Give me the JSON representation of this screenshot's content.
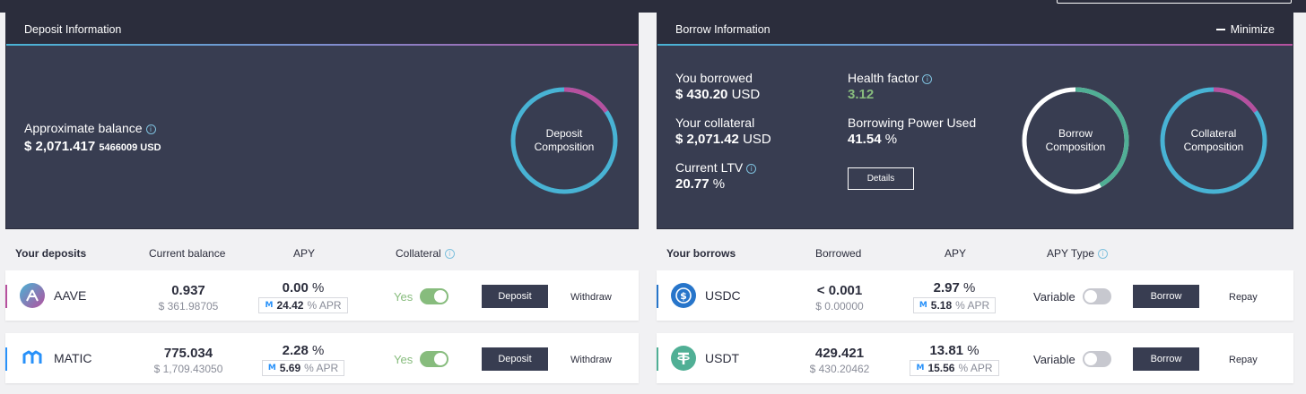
{
  "deposit_panel": {
    "title": "Deposit Information",
    "approx_label": "Approximate balance",
    "approx_prefix": "$",
    "approx_main": "2,071.417",
    "approx_small": "5466009 USD",
    "donut_line1": "Deposit",
    "donut_line2": "Composition"
  },
  "borrow_panel": {
    "title": "Borrow Information",
    "minimize": "Minimize",
    "you_borrowed_label": "You borrowed",
    "you_borrowed_value": "$ 430.20",
    "you_borrowed_unit": "USD",
    "collateral_label": "Your collateral",
    "collateral_value": "$ 2,071.42",
    "collateral_unit": "USD",
    "ltv_label": "Current LTV",
    "ltv_value": "20.77",
    "ltv_unit": "%",
    "health_label": "Health factor",
    "health_value": "3.12",
    "power_label": "Borrowing Power Used",
    "power_value": "41.54",
    "power_unit": "%",
    "details_label": "Details",
    "borrow_donut_line1": "Borrow",
    "borrow_donut_line2": "Composition",
    "collateral_donut_line1": "Collateral",
    "collateral_donut_line2": "Composition"
  },
  "deposits_table": {
    "headers": [
      "Your deposits",
      "Current balance",
      "APY",
      "Collateral"
    ],
    "rows": [
      {
        "asset": "AAVE",
        "balance": "0.937",
        "balance_usd": "$ 361.98705",
        "apy": "0.00",
        "apy_unit": "%",
        "apr": "24.42",
        "apr_unit": "% APR",
        "collateral": "Yes",
        "deposit_label": "Deposit",
        "withdraw_label": "Withdraw"
      },
      {
        "asset": "MATIC",
        "balance": "775.034",
        "balance_usd": "$ 1,709.43050",
        "apy": "2.28",
        "apy_unit": "%",
        "apr": "5.69",
        "apr_unit": "% APR",
        "collateral": "Yes",
        "deposit_label": "Deposit",
        "withdraw_label": "Withdraw"
      }
    ]
  },
  "borrows_table": {
    "headers": [
      "Your borrows",
      "Borrowed",
      "APY",
      "APY Type"
    ],
    "rows": [
      {
        "asset": "USDC",
        "borrowed": "< 0.001",
        "borrowed_usd": "$ 0.00000",
        "apy": "2.97",
        "apy_unit": "%",
        "apr": "5.18",
        "apr_unit": "% APR",
        "apy_type": "Variable",
        "borrow_label": "Borrow",
        "repay_label": "Repay"
      },
      {
        "asset": "USDT",
        "borrowed": "429.421",
        "borrowed_usd": "$ 430.20462",
        "apy": "13.81",
        "apy_unit": "%",
        "apr": "15.56",
        "apr_unit": "% APR",
        "apy_type": "Variable",
        "borrow_label": "Borrow",
        "repay_label": "Repay"
      }
    ]
  },
  "icons": {
    "info": "i",
    "apr_badge": "M"
  },
  "colors": {
    "panel_bg": "#383d51",
    "header_bg": "#2b2d3c",
    "green": "#87bc7d",
    "blue": "#48b3d4",
    "purple": "#b6509e",
    "aave_accent": "#b6509e",
    "matic_accent": "#2891f9",
    "usdc_accent": "#2775ca",
    "usdt_accent": "#50af95"
  }
}
